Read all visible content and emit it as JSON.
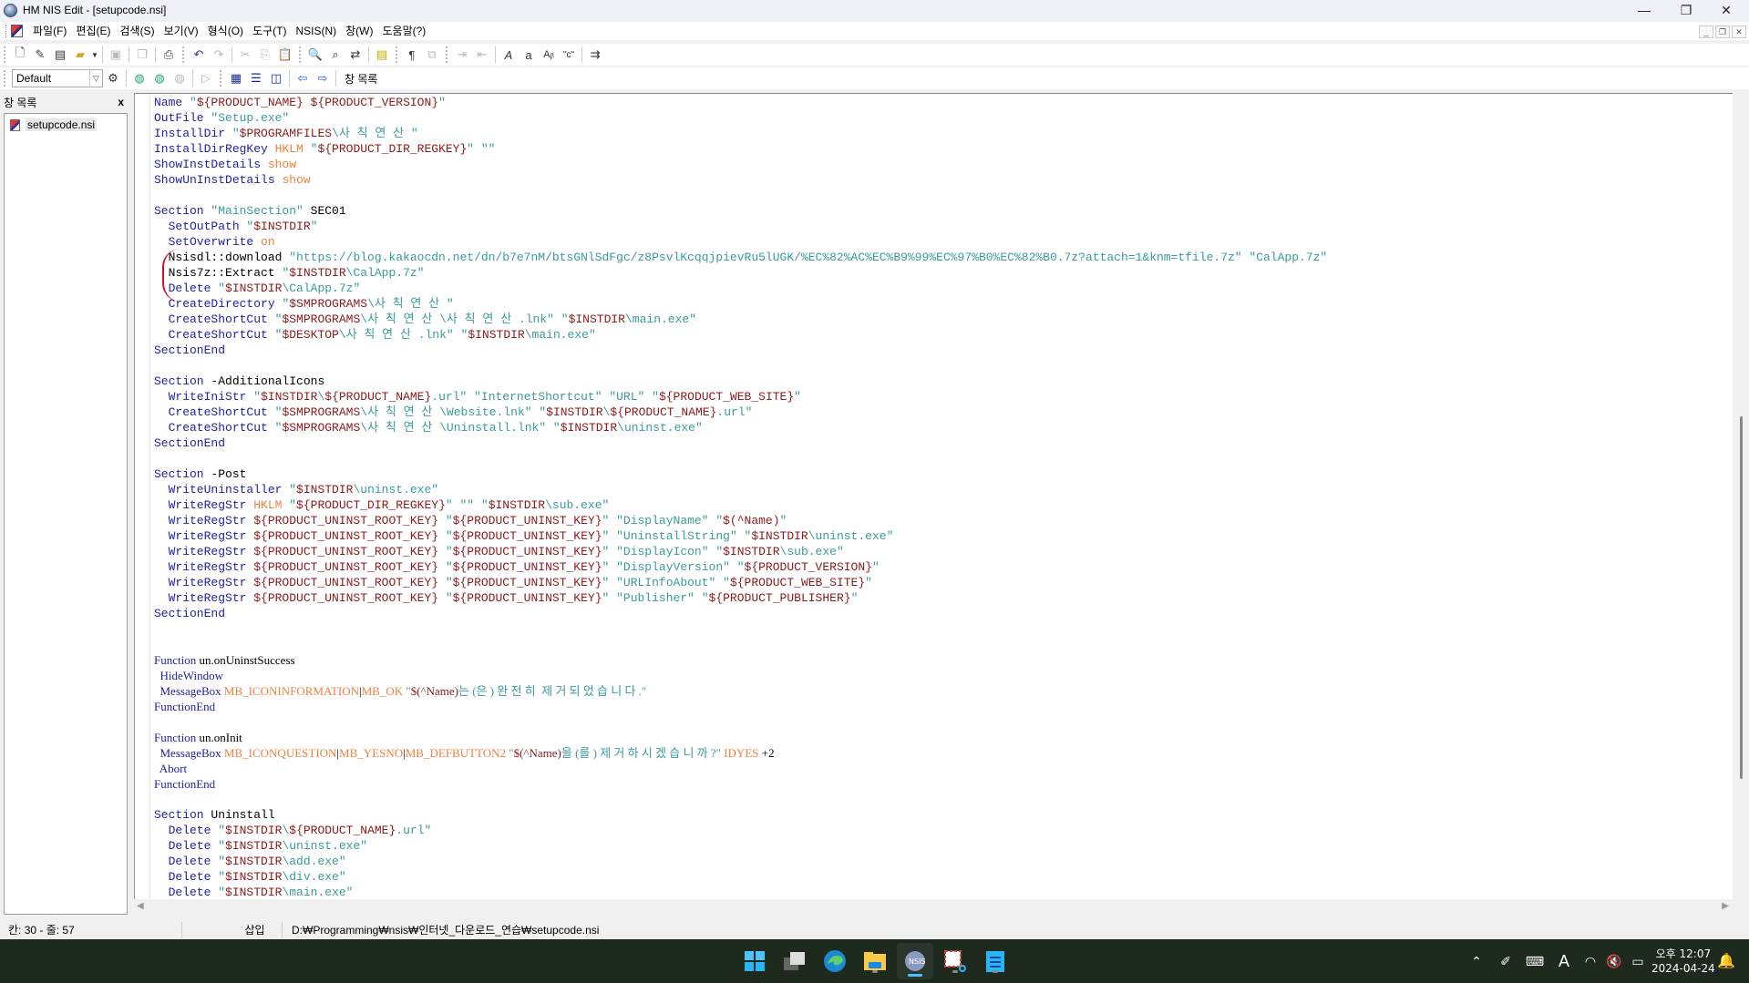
{
  "window": {
    "title": "HM NIS Edit - [setupcode.nsi]",
    "controls": {
      "minimize": "—",
      "maximize": "❐",
      "close": "✕"
    }
  },
  "menu": {
    "items": [
      {
        "label": "파일(F)"
      },
      {
        "label": "편집(E)"
      },
      {
        "label": "검색(S)"
      },
      {
        "label": "보기(V)"
      },
      {
        "label": "형식(O)"
      },
      {
        "label": "도구(T)"
      },
      {
        "label": "NSIS(N)"
      },
      {
        "label": "창(W)"
      },
      {
        "label": "도움말(?)"
      }
    ],
    "mdi_controls": {
      "minimize": "_",
      "restore": "❐",
      "close": "✕"
    }
  },
  "toolbar": {
    "profile_select": "Default",
    "window_list_label": "창 목록"
  },
  "sidebar": {
    "title": "창 목록",
    "close": "x",
    "files": [
      {
        "name": "setupcode.nsi"
      }
    ]
  },
  "editor": {
    "lines": [
      [
        [
          "kw",
          "Name "
        ],
        [
          "str",
          "\""
        ],
        [
          "var",
          "${PRODUCT_NAME} ${PRODUCT_VERSION}"
        ],
        [
          "str",
          "\""
        ]
      ],
      [
        [
          "kw",
          "OutFile "
        ],
        [
          "str",
          "\"Setup.exe\""
        ]
      ],
      [
        [
          "kw",
          "InstallDir "
        ],
        [
          "str",
          "\""
        ],
        [
          "var",
          "$PROGRAMFILES"
        ],
        [
          "str",
          "\\사 칙 연 산 \""
        ]
      ],
      [
        [
          "kw",
          "InstallDirRegKey "
        ],
        [
          "cst",
          "HKLM "
        ],
        [
          "str",
          "\""
        ],
        [
          "var",
          "${PRODUCT_DIR_REGKEY}"
        ],
        [
          "str",
          "\" \"\""
        ]
      ],
      [
        [
          "kw",
          "ShowInstDetails "
        ],
        [
          "cst",
          "show"
        ]
      ],
      [
        [
          "kw",
          "ShowUnInstDetails "
        ],
        [
          "cst",
          "show"
        ]
      ],
      [],
      [
        [
          "kw",
          "Section "
        ],
        [
          "str",
          "\"MainSection\" "
        ],
        [
          "plain",
          "SEC01"
        ]
      ],
      [
        [
          "kw",
          "  SetOutPath "
        ],
        [
          "str",
          "\""
        ],
        [
          "var",
          "$INSTDIR"
        ],
        [
          "str",
          "\""
        ]
      ],
      [
        [
          "kw",
          "  SetOverwrite "
        ],
        [
          "cst",
          "on"
        ]
      ],
      [
        [
          "plain",
          "  Nsisdl::download "
        ],
        [
          "str",
          "\"https://blog.kakaocdn.net/dn/b7e7nM/btsGNlSdFgc/z8PsvlKcqqjpievRu5lUGK/%EC%82%AC%EC%B9%99%EC%97%B0%EC%82%B0.7z?attach=1&knm=tfile.7z\" \"CalApp.7z\""
        ]
      ],
      [
        [
          "plain",
          "  Nsis7z::Extract "
        ],
        [
          "str",
          "\""
        ],
        [
          "var",
          "$INSTDIR"
        ],
        [
          "str",
          "\\CalApp.7z\""
        ]
      ],
      [
        [
          "kw",
          "  Delete "
        ],
        [
          "str",
          "\""
        ],
        [
          "var",
          "$INSTDIR"
        ],
        [
          "str",
          "\\CalApp.7z\""
        ]
      ],
      [
        [
          "kw",
          "  CreateDirectory "
        ],
        [
          "str",
          "\""
        ],
        [
          "var",
          "$SMPROGRAMS"
        ],
        [
          "str",
          "\\사 칙 연 산 \""
        ]
      ],
      [
        [
          "kw",
          "  CreateShortCut "
        ],
        [
          "str",
          "\""
        ],
        [
          "var",
          "$SMPROGRAMS"
        ],
        [
          "str",
          "\\사 칙 연 산 \\사 칙 연 산 .lnk\" \""
        ],
        [
          "var",
          "$INSTDIR"
        ],
        [
          "str",
          "\\main.exe\""
        ]
      ],
      [
        [
          "kw",
          "  CreateShortCut "
        ],
        [
          "str",
          "\""
        ],
        [
          "var",
          "$DESKTOP"
        ],
        [
          "str",
          "\\사 칙 연 산 .lnk\" \""
        ],
        [
          "var",
          "$INSTDIR"
        ],
        [
          "str",
          "\\main.exe\""
        ]
      ],
      [
        [
          "kw",
          "SectionEnd"
        ]
      ],
      [],
      [
        [
          "kw",
          "Section "
        ],
        [
          "plain",
          "-AdditionalIcons"
        ]
      ],
      [
        [
          "kw",
          "  WriteIniStr "
        ],
        [
          "str",
          "\""
        ],
        [
          "var",
          "$INSTDIR"
        ],
        [
          "str",
          "\\"
        ],
        [
          "var",
          "${PRODUCT_NAME}"
        ],
        [
          "str",
          ".url\" \"InternetShortcut\" \"URL\" \""
        ],
        [
          "var",
          "${PRODUCT_WEB_SITE}"
        ],
        [
          "str",
          "\""
        ]
      ],
      [
        [
          "kw",
          "  CreateShortCut "
        ],
        [
          "str",
          "\""
        ],
        [
          "var",
          "$SMPROGRAMS"
        ],
        [
          "str",
          "\\사 칙 연 산 \\Website.lnk\" \""
        ],
        [
          "var",
          "$INSTDIR"
        ],
        [
          "str",
          "\\"
        ],
        [
          "var",
          "${PRODUCT_NAME}"
        ],
        [
          "str",
          ".url\""
        ]
      ],
      [
        [
          "kw",
          "  CreateShortCut "
        ],
        [
          "str",
          "\""
        ],
        [
          "var",
          "$SMPROGRAMS"
        ],
        [
          "str",
          "\\사 칙 연 산 \\Uninstall.lnk\" \""
        ],
        [
          "var",
          "$INSTDIR"
        ],
        [
          "str",
          "\\uninst.exe\""
        ]
      ],
      [
        [
          "kw",
          "SectionEnd"
        ]
      ],
      [],
      [
        [
          "kw",
          "Section "
        ],
        [
          "plain",
          "-Post"
        ]
      ],
      [
        [
          "kw",
          "  WriteUninstaller "
        ],
        [
          "str",
          "\""
        ],
        [
          "var",
          "$INSTDIR"
        ],
        [
          "str",
          "\\uninst.exe\""
        ]
      ],
      [
        [
          "kw",
          "  WriteRegStr "
        ],
        [
          "cst",
          "HKLM "
        ],
        [
          "str",
          "\""
        ],
        [
          "var",
          "${PRODUCT_DIR_REGKEY}"
        ],
        [
          "str",
          "\" \"\" \""
        ],
        [
          "var",
          "$INSTDIR"
        ],
        [
          "str",
          "\\sub.exe\""
        ]
      ],
      [
        [
          "kw",
          "  WriteRegStr "
        ],
        [
          "var",
          "${PRODUCT_UNINST_ROOT_KEY} "
        ],
        [
          "str",
          "\""
        ],
        [
          "var",
          "${PRODUCT_UNINST_KEY}"
        ],
        [
          "str",
          "\" \"DisplayName\" \""
        ],
        [
          "var",
          "$(^Name)"
        ],
        [
          "str",
          "\""
        ]
      ],
      [
        [
          "kw",
          "  WriteRegStr "
        ],
        [
          "var",
          "${PRODUCT_UNINST_ROOT_KEY} "
        ],
        [
          "str",
          "\""
        ],
        [
          "var",
          "${PRODUCT_UNINST_KEY}"
        ],
        [
          "str",
          "\" \"UninstallString\" \""
        ],
        [
          "var",
          "$INSTDIR"
        ],
        [
          "str",
          "\\uninst.exe\""
        ]
      ],
      [
        [
          "kw",
          "  WriteRegStr "
        ],
        [
          "var",
          "${PRODUCT_UNINST_ROOT_KEY} "
        ],
        [
          "str",
          "\""
        ],
        [
          "var",
          "${PRODUCT_UNINST_KEY}"
        ],
        [
          "str",
          "\" \"DisplayIcon\" \""
        ],
        [
          "var",
          "$INSTDIR"
        ],
        [
          "str",
          "\\sub.exe\""
        ]
      ],
      [
        [
          "kw",
          "  WriteRegStr "
        ],
        [
          "var",
          "${PRODUCT_UNINST_ROOT_KEY} "
        ],
        [
          "str",
          "\""
        ],
        [
          "var",
          "${PRODUCT_UNINST_KEY}"
        ],
        [
          "str",
          "\" \"DisplayVersion\" \""
        ],
        [
          "var",
          "${PRODUCT_VERSION}"
        ],
        [
          "str",
          "\""
        ]
      ],
      [
        [
          "kw",
          "  WriteRegStr "
        ],
        [
          "var",
          "${PRODUCT_UNINST_ROOT_KEY} "
        ],
        [
          "str",
          "\""
        ],
        [
          "var",
          "${PRODUCT_UNINST_KEY}"
        ],
        [
          "str",
          "\" \"URLInfoAbout\" \""
        ],
        [
          "var",
          "${PRODUCT_WEB_SITE}"
        ],
        [
          "str",
          "\""
        ]
      ],
      [
        [
          "kw",
          "  WriteRegStr "
        ],
        [
          "var",
          "${PRODUCT_UNINST_ROOT_KEY} "
        ],
        [
          "str",
          "\""
        ],
        [
          "var",
          "${PRODUCT_UNINST_KEY}"
        ],
        [
          "str",
          "\" \"Publisher\" \""
        ],
        [
          "var",
          "${PRODUCT_PUBLISHER}"
        ],
        [
          "str",
          "\""
        ]
      ],
      [
        [
          "kw",
          "SectionEnd"
        ]
      ],
      [],
      [],
      [
        [
          "kw",
          "Function "
        ],
        [
          "plain",
          "un.onUninstSuccess"
        ]
      ],
      [
        [
          "kw",
          "  HideWindow"
        ]
      ],
      [
        [
          "kw",
          "  MessageBox "
        ],
        [
          "cst",
          "MB_ICONINFORMATION"
        ],
        [
          "plain",
          "|"
        ],
        [
          "cst",
          "MB_OK "
        ],
        [
          "str",
          "\""
        ],
        [
          "var",
          "$(^Name)"
        ],
        [
          "str",
          "는 (은 ) 완 전 히  제 거 되 었 습 니 다 .\""
        ]
      ],
      [
        [
          "kw",
          "FunctionEnd"
        ]
      ],
      [],
      [
        [
          "kw",
          "Function "
        ],
        [
          "plain",
          "un.onInit"
        ]
      ],
      [
        [
          "kw",
          "  MessageBox "
        ],
        [
          "cst",
          "MB_ICONQUESTION"
        ],
        [
          "plain",
          "|"
        ],
        [
          "cst",
          "MB_YESNO"
        ],
        [
          "plain",
          "|"
        ],
        [
          "cst",
          "MB_DEFBUTTON2 "
        ],
        [
          "str",
          "\""
        ],
        [
          "var",
          "$(^Name)"
        ],
        [
          "str",
          "을 (를 ) 제 거 하 시 겠 습 니 까 ?\" "
        ],
        [
          "cst",
          "IDYES "
        ],
        [
          "plain",
          "+2"
        ]
      ],
      [
        [
          "kw",
          "  Abort"
        ]
      ],
      [
        [
          "kw",
          "FunctionEnd"
        ]
      ],
      [],
      [
        [
          "kw",
          "Section "
        ],
        [
          "plain",
          "Uninstall"
        ]
      ],
      [
        [
          "kw",
          "  Delete "
        ],
        [
          "str",
          "\""
        ],
        [
          "var",
          "$INSTDIR"
        ],
        [
          "str",
          "\\"
        ],
        [
          "var",
          "${PRODUCT_NAME}"
        ],
        [
          "str",
          ".url\""
        ]
      ],
      [
        [
          "kw",
          "  Delete "
        ],
        [
          "str",
          "\""
        ],
        [
          "var",
          "$INSTDIR"
        ],
        [
          "str",
          "\\uninst.exe\""
        ]
      ],
      [
        [
          "kw",
          "  Delete "
        ],
        [
          "str",
          "\""
        ],
        [
          "var",
          "$INSTDIR"
        ],
        [
          "str",
          "\\add.exe\""
        ]
      ],
      [
        [
          "kw",
          "  Delete "
        ],
        [
          "str",
          "\""
        ],
        [
          "var",
          "$INSTDIR"
        ],
        [
          "str",
          "\\div.exe\""
        ]
      ],
      [
        [
          "kw",
          "  Delete "
        ],
        [
          "str",
          "\""
        ],
        [
          "var",
          "$INSTDIR"
        ],
        [
          "str",
          "\\main.exe\""
        ]
      ]
    ],
    "serif_lines": [
      36,
      37,
      38,
      39,
      41,
      42,
      43,
      44
    ],
    "vertical_scroll_position": 0.5
  },
  "statusbar": {
    "position": "칸: 30 - 줄: 57",
    "mode": "삽입",
    "path": "D:₩Programming₩nsis₩인터넷_다운로드_연습₩setupcode.nsi"
  },
  "taskbar": {
    "apps": [
      {
        "name": "start"
      },
      {
        "name": "task-view"
      },
      {
        "name": "edge"
      },
      {
        "name": "file-explorer"
      },
      {
        "name": "hm-nis-edit",
        "active": true
      },
      {
        "name": "snipping-tool"
      },
      {
        "name": "notepad"
      }
    ],
    "clock": {
      "ampm_time": "오후 12:07",
      "date": "2024-04-24"
    }
  },
  "colors": {
    "keyword": "#1f1fa0",
    "string": "#3a9a9a",
    "variable": "#8b1a1a",
    "constant": "#f08040",
    "taskbar": "#1e2a1e",
    "accent": "#4cc2ff"
  }
}
